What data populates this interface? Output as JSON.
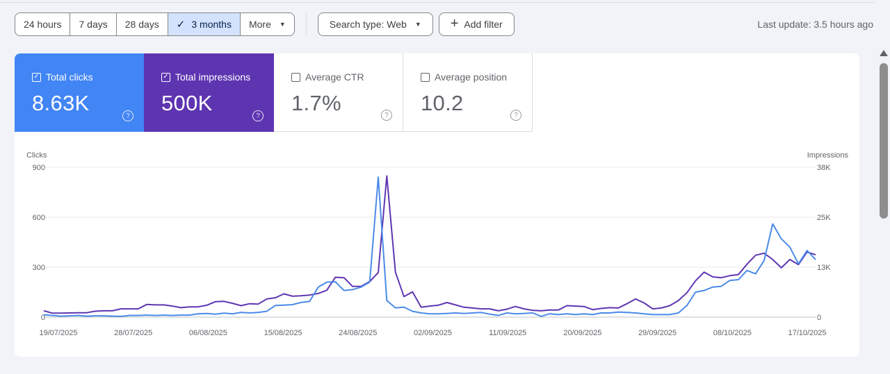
{
  "toolbar": {
    "ranges": [
      {
        "label": "24 hours",
        "selected": false
      },
      {
        "label": "7 days",
        "selected": false
      },
      {
        "label": "28 days",
        "selected": false
      },
      {
        "label": "3 months",
        "selected": true
      },
      {
        "label": "More",
        "selected": false
      }
    ],
    "search_type": "Search type: Web",
    "add_filter": "Add filter",
    "last_update": "Last update: 3.5 hours ago"
  },
  "metrics": [
    {
      "label": "Total clicks",
      "value": "8.63K",
      "checked": true,
      "color": "#4285f4"
    },
    {
      "label": "Total impressions",
      "value": "500K",
      "checked": true,
      "color": "#5e35b1"
    },
    {
      "label": "Average CTR",
      "value": "1.7%",
      "checked": false
    },
    {
      "label": "Average position",
      "value": "10.2",
      "checked": false
    }
  ],
  "colors": {
    "clicks": "#4a8ae8",
    "impressions": "#5e35b1",
    "accent": "#d3e3fd"
  },
  "chart_data": {
    "type": "line",
    "ylabel_left": "Clicks",
    "ylabel_right": "Impressions",
    "ylim_left": [
      0,
      900
    ],
    "ylim_right": [
      0,
      38000
    ],
    "yticks_left": [
      "900",
      "600",
      "300",
      "0"
    ],
    "yticks_right": [
      "38K",
      "25K",
      "13K",
      "0"
    ],
    "xticks": [
      "19/07/2025",
      "28/07/2025",
      "06/08/2025",
      "15/08/2025",
      "24/08/2025",
      "02/09/2025",
      "11/09/2025",
      "20/09/2025",
      "29/09/2025",
      "08/10/2025",
      "17/10/2025"
    ],
    "grid": true,
    "series": [
      {
        "name": "Clicks",
        "axis": "left",
        "values": [
          14,
          10,
          6,
          8,
          10,
          6,
          8,
          8,
          6,
          4,
          10,
          10,
          12,
          10,
          12,
          10,
          12,
          12,
          20,
          22,
          18,
          24,
          20,
          28,
          25,
          28,
          35,
          70,
          72,
          75,
          88,
          94,
          180,
          210,
          212,
          160,
          165,
          180,
          210,
          840,
          100,
          55,
          60,
          35,
          25,
          20,
          20,
          22,
          25,
          22,
          25,
          28,
          18,
          10,
          25,
          20,
          22,
          25,
          5,
          20,
          15,
          20,
          15,
          20,
          15,
          25,
          25,
          30,
          28,
          25,
          20,
          15,
          15,
          15,
          25,
          70,
          150,
          160,
          180,
          185,
          220,
          225,
          280,
          260,
          340,
          560,
          470,
          420,
          320,
          400,
          345
        ]
      },
      {
        "name": "Impressions",
        "axis": "right",
        "values": [
          1600,
          1000,
          1000,
          1050,
          1100,
          1100,
          1500,
          1600,
          1600,
          2100,
          2100,
          2100,
          3200,
          3100,
          3100,
          2800,
          2400,
          2600,
          2600,
          3000,
          3900,
          4000,
          3500,
          2900,
          3400,
          3300,
          4600,
          4900,
          5900,
          5300,
          5400,
          5600,
          6000,
          6800,
          10100,
          10000,
          7800,
          7800,
          9000,
          11300,
          35800,
          11400,
          5200,
          6400,
          2500,
          2800,
          3000,
          3700,
          3100,
          2500,
          2300,
          2100,
          2100,
          1600,
          2000,
          2700,
          2100,
          1700,
          1600,
          1800,
          1800,
          2900,
          2800,
          2700,
          1900,
          2200,
          2400,
          2300,
          3400,
          4600,
          3600,
          2100,
          2300,
          2900,
          4200,
          6200,
          9200,
          11400,
          10200,
          10000,
          10500,
          10800,
          13400,
          15700,
          16200,
          14600,
          12500,
          14600,
          13300,
          16500,
          15800
        ]
      }
    ]
  }
}
